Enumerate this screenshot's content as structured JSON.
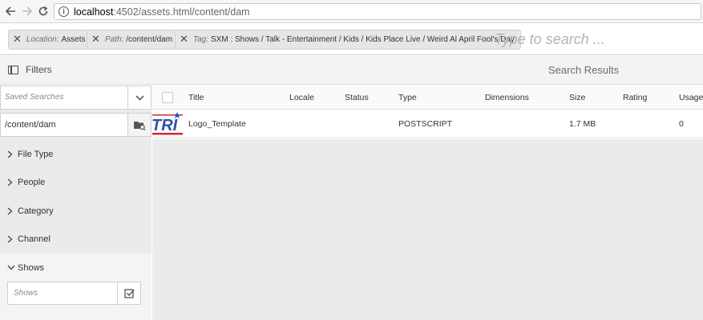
{
  "browser": {
    "url_host": "localhost",
    "url_path": ":4502/assets.html/content/dam",
    "info_glyph": "i",
    "icons": [
      "back-arrow-icon",
      "forward-arrow-icon",
      "reload-icon",
      "info-icon"
    ]
  },
  "omnisearch": {
    "tags": [
      {
        "key": "Location:",
        "value": "Assets"
      },
      {
        "key": "Path:",
        "value": "/content/dam"
      },
      {
        "key": "Tag:",
        "value": "SXM : Shows / Talk - Entertainment / Kids / Kids Place Live / Weird Al April Fool's Day"
      }
    ],
    "remove_glyph": "✕",
    "placeholder": "Type to search ..."
  },
  "rail": {
    "title": "Filters",
    "saved_searches_placeholder": "Saved Searches",
    "path_value": "/content/dam",
    "facets": [
      "File Type",
      "People",
      "Category",
      "Channel"
    ],
    "shows": {
      "label": "Shows",
      "input_placeholder": "Shows"
    }
  },
  "results": {
    "title": "Search Results",
    "columns": [
      "Title",
      "Locale",
      "Status",
      "Type",
      "Dimensions",
      "Size",
      "Rating",
      "Usage"
    ],
    "rows": [
      {
        "title": "Logo_Template",
        "locale": "",
        "status": "",
        "type": "POSTSCRIPT",
        "dimensions": "",
        "size": "1.7 MB",
        "rating": "",
        "usage": "0",
        "thumb_text": "TRI"
      }
    ]
  },
  "colors": {
    "accent_blue": "#2a52a8",
    "accent_red": "#d7262e",
    "rail_bg": "#ebebeb"
  }
}
